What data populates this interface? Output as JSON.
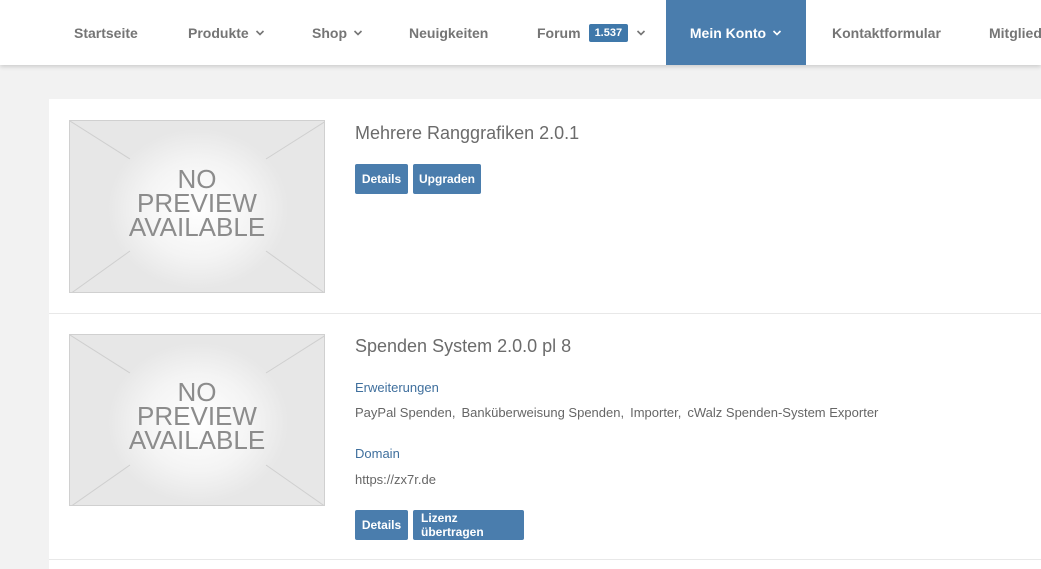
{
  "nav": {
    "items": [
      {
        "label": "Startseite"
      },
      {
        "label": "Produkte"
      },
      {
        "label": "Shop"
      },
      {
        "label": "Neuigkeiten"
      },
      {
        "label": "Forum",
        "badge": "1.537"
      },
      {
        "label": "Mein Konto"
      },
      {
        "label": "Kontaktformular"
      },
      {
        "label": "Mitglied"
      }
    ],
    "active_color": "#4a7dad"
  },
  "products": [
    {
      "title": "Mehrere Ranggrafiken 2.0.1",
      "preview_text": [
        "NO",
        "PREVIEW",
        "AVAILABLE"
      ],
      "buttons": [
        "Details",
        "Upgraden"
      ]
    },
    {
      "title": "Spenden System 2.0.0 pl 8",
      "preview_text": [
        "NO",
        "PREVIEW",
        "AVAILABLE"
      ],
      "extensions_label": "Erweiterungen",
      "extensions": [
        "PayPal Spenden,",
        "Banküberweisung Spenden,",
        "Importer,",
        "cWalz Spenden-System Exporter"
      ],
      "domain_label": "Domain",
      "domain": "https://zx7r.de",
      "buttons": [
        "Details",
        "Lizenz übertragen"
      ]
    }
  ]
}
